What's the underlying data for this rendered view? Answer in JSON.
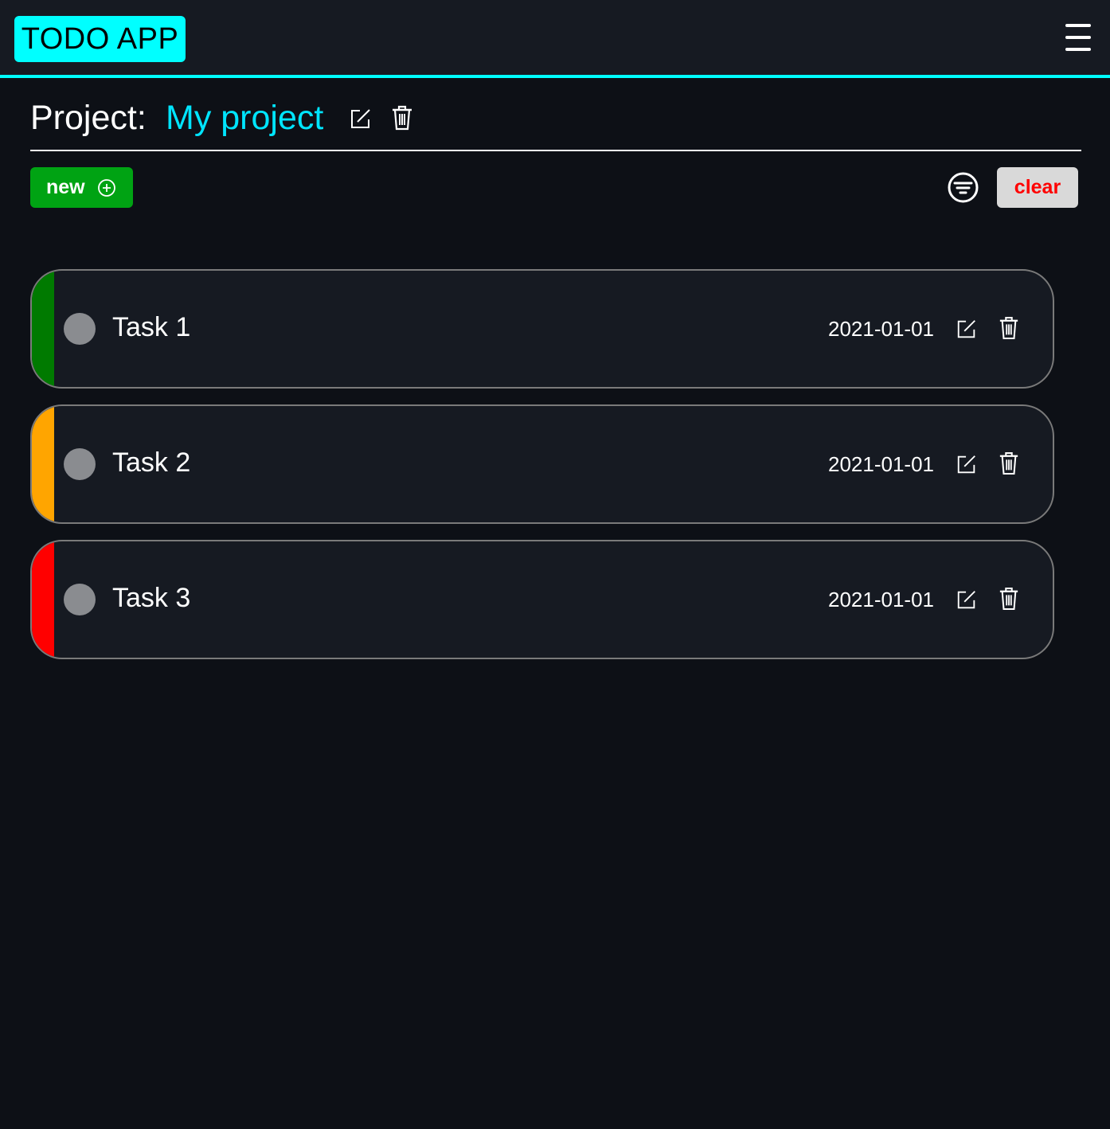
{
  "app": {
    "title": "TODO APP"
  },
  "header": {
    "menu_icon": "hamburger-menu-icon"
  },
  "project": {
    "label": "Project:",
    "name": "My project",
    "edit_icon": "edit-icon",
    "delete_icon": "trash-icon"
  },
  "toolbar": {
    "new_label": "new",
    "new_icon": "plus-circle-icon",
    "filter_icon": "filter-icon",
    "clear_label": "clear"
  },
  "colors": {
    "accent": "#00ffff",
    "project_name": "#00e5ff",
    "new_button": "#00a313",
    "clear_text": "#ff0000",
    "background": "#0d1016",
    "card": "#161a22"
  },
  "tasks": [
    {
      "title": "Task 1",
      "date": "2021-01-01",
      "priority_color": "#007a00"
    },
    {
      "title": "Task 2",
      "date": "2021-01-01",
      "priority_color": "#ffa500"
    },
    {
      "title": "Task 3",
      "date": "2021-01-01",
      "priority_color": "#ff0000"
    }
  ]
}
